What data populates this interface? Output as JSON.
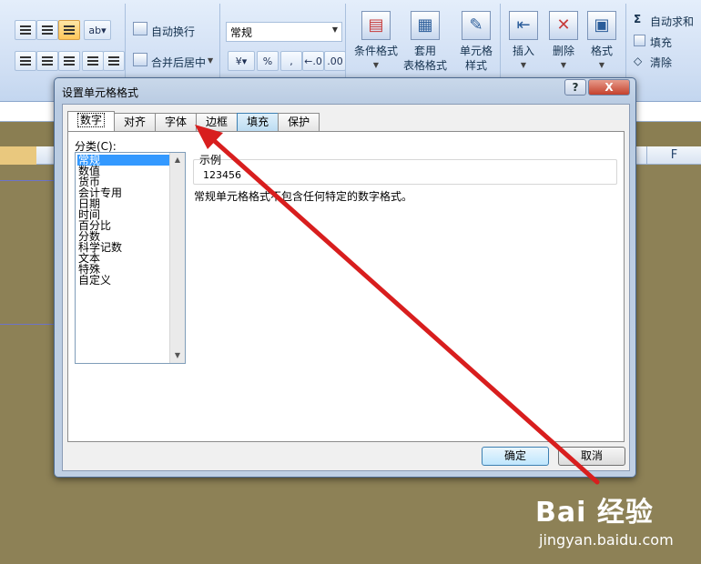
{
  "ribbon": {
    "wrap_text": "自动换行",
    "merge_center": "合并后居中",
    "number_format": "常规",
    "percent": "%",
    "comma": ",",
    "inc_decimal": "←.0",
    "dec_decimal": ".00",
    "cond_format": "条件格式",
    "table_format_1": "套用",
    "table_format_2": "表格格式",
    "cell_style_1": "单元格",
    "cell_style_2": "样式",
    "insert": "插入",
    "delete": "删除",
    "format": "格式",
    "autosum": "自动求和",
    "fill": "填充",
    "clear": "清除"
  },
  "sheet": {
    "column_f": "F"
  },
  "dialog": {
    "title": "设置单元格格式",
    "help": "?",
    "close": "X",
    "tabs": [
      {
        "label": "数字"
      },
      {
        "label": "对齐"
      },
      {
        "label": "字体"
      },
      {
        "label": "边框"
      },
      {
        "label": "填充"
      },
      {
        "label": "保护"
      }
    ],
    "category_label": "分类(C):",
    "categories": [
      {
        "label": "常规"
      },
      {
        "label": "数值"
      },
      {
        "label": "货币"
      },
      {
        "label": "会计专用"
      },
      {
        "label": "日期"
      },
      {
        "label": "时间"
      },
      {
        "label": "百分比"
      },
      {
        "label": "分数"
      },
      {
        "label": "科学记数"
      },
      {
        "label": "文本"
      },
      {
        "label": "特殊"
      },
      {
        "label": "自定义"
      }
    ],
    "sample_label": "示例",
    "sample_value": "123456",
    "description": "常规单元格格式不包含任何特定的数字格式。",
    "ok": "确定",
    "cancel": "取消"
  },
  "watermark": {
    "brand": "Bai 经验",
    "url": "jingyan.baidu.com"
  },
  "colors": {
    "arrow": "#d81e1e",
    "selection": "#3399ff",
    "sheet_bg": "#8d8156"
  }
}
